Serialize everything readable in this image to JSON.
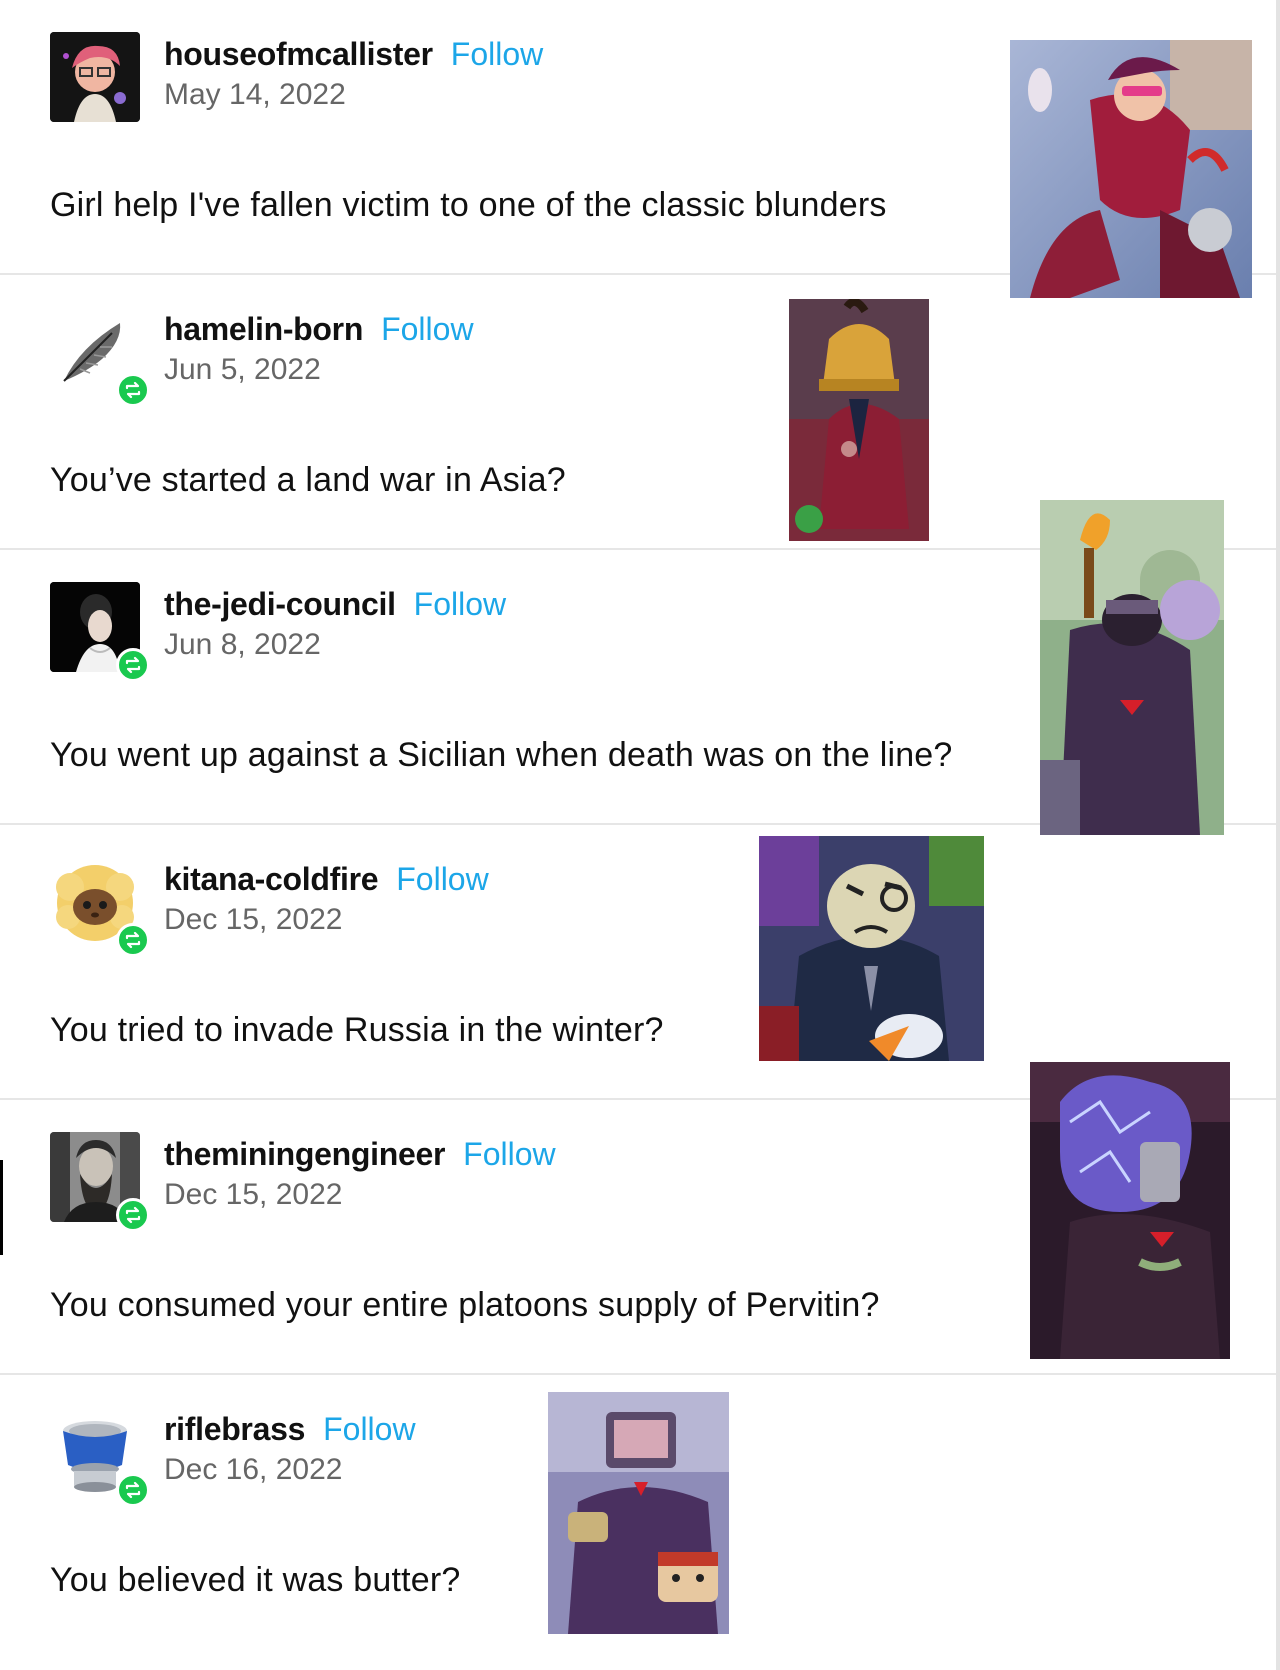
{
  "posts": [
    {
      "username": "houseofmcallister",
      "follow_label": "Follow",
      "date": "May 14, 2022",
      "text": "Girl help I've fallen victim to one of the classic blunders",
      "reblogged": false,
      "avatar_icon": "pink-haired-drawn-character-avatar"
    },
    {
      "username": "hamelin-born",
      "follow_label": "Follow",
      "date": "Jun 5, 2022",
      "text": "You’ve started a land war in Asia?",
      "reblogged": true,
      "avatar_icon": "feather-avatar"
    },
    {
      "username": "the-jedi-council",
      "follow_label": "Follow",
      "date": "Jun 8, 2022",
      "text": "You went up against a Sicilian when death was on the line?",
      "reblogged": true,
      "avatar_icon": "dark-portrait-avatar"
    },
    {
      "username": "kitana-coldfire",
      "follow_label": "Follow",
      "date": "Dec 15, 2022",
      "text": "You tried to invade Russia in the winter?",
      "reblogged": true,
      "avatar_icon": "fluffy-sheep-avatar"
    },
    {
      "username": "theminingengineer",
      "follow_label": "Follow",
      "date": "Dec 15, 2022",
      "text": "You consumed your entire platoons supply of Pervitin?",
      "reblogged": true,
      "avatar_icon": "bearded-man-photo-avatar"
    },
    {
      "username": "riflebrass",
      "follow_label": "Follow",
      "date": "Dec 16, 2022",
      "text": "You believed it was butter?",
      "reblogged": true,
      "avatar_icon": "blue-tumbler-avatar"
    }
  ],
  "artwork": [
    "red-suited-villain-leaping-art",
    "bell-headed-gentleman-art",
    "torch-bearing-villain-art",
    "monocled-moon-villain-art",
    "purple-haired-knight-art",
    "tv-headed-villain-eating-art"
  ],
  "colors": {
    "follow": "#1ca6e8",
    "reblog_badge": "#1ac94f",
    "divider": "#e6e6e6",
    "text": "#111111",
    "date": "#666666"
  }
}
